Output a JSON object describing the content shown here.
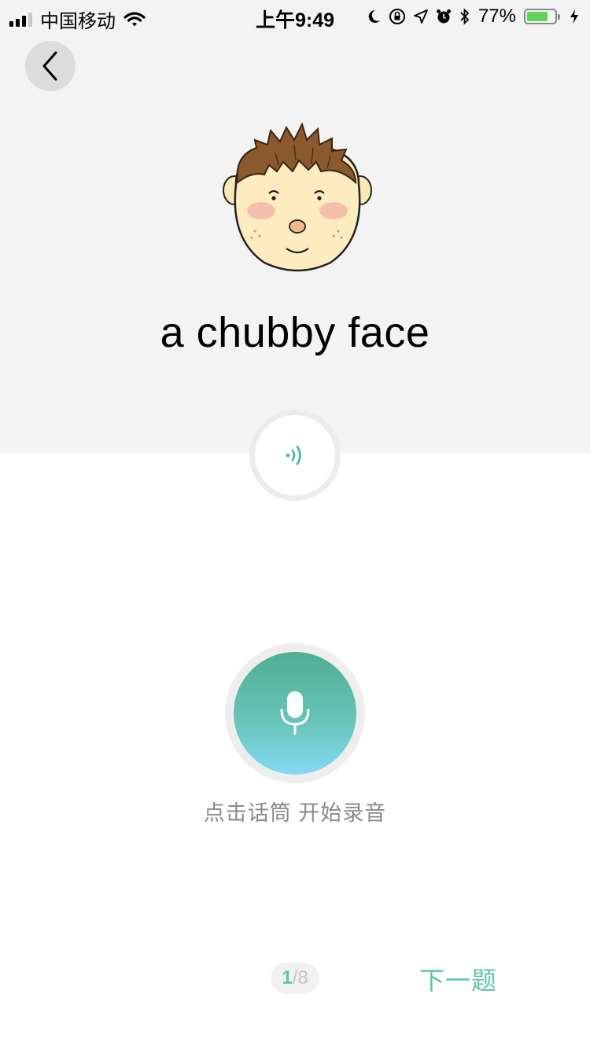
{
  "status_bar": {
    "carrier": "中国移动",
    "time": "上午9:49",
    "battery_percent_text": "77%",
    "battery_level": 0.77,
    "icons": [
      "signal-icon",
      "wifi-icon",
      "moon-icon",
      "rotation-lock-icon",
      "location-icon",
      "alarm-icon",
      "bluetooth-icon",
      "battery-icon",
      "charging-icon"
    ]
  },
  "nav": {
    "back_icon": "chevron-left-icon"
  },
  "card": {
    "image": "chubby-face-cartoon",
    "phrase": "a chubby face",
    "play_icon": "sound-wave-icon"
  },
  "record": {
    "mic_icon": "microphone-icon",
    "hint": "点击话筒 开始录音",
    "gradient_top": "#4fae93",
    "gradient_bottom": "#84d9f3"
  },
  "footer": {
    "progress_current": "1",
    "progress_separator": "/",
    "progress_total": "8",
    "next_label": "下一题"
  },
  "colors": {
    "accent": "#5fc4a8",
    "top_bg": "#f3f3f3"
  }
}
